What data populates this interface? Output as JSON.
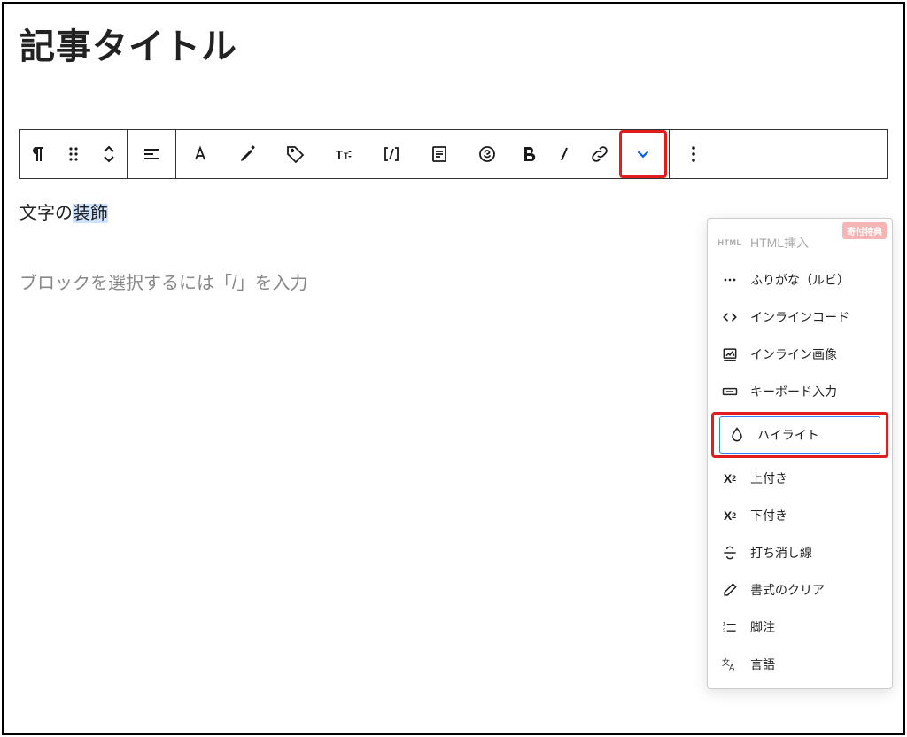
{
  "page_title": "記事タイトル",
  "content": {
    "prefix": "文字の",
    "highlighted": "装飾"
  },
  "placeholder": "ブロックを選択するには「/」を入力",
  "toolbar": {
    "paragraph": "段落",
    "drag": "ドラッグ",
    "move": "移動",
    "align": "配置",
    "text_color": "テキスト色",
    "highlight": "マーカー",
    "tag": "タグ",
    "font_size": "フォントサイズ",
    "shortcode": "ショートコード",
    "note": "注釈",
    "badge": "バッジ",
    "bold": "太字",
    "italic": "イタリック",
    "link": "リンク",
    "more": "さらに表示",
    "options": "オプション"
  },
  "dropdown": {
    "badge_label": "寄付特典",
    "items": [
      {
        "id": "html",
        "label": "HTML挿入",
        "icon_text": "HTML",
        "disabled": true
      },
      {
        "id": "ruby",
        "label": "ふりがな（ルビ）"
      },
      {
        "id": "code",
        "label": "インラインコード"
      },
      {
        "id": "image",
        "label": "インライン画像"
      },
      {
        "id": "kbd",
        "label": "キーボード入力"
      },
      {
        "id": "highlight",
        "label": "ハイライト",
        "selected": true
      },
      {
        "id": "sup",
        "label": "上付き"
      },
      {
        "id": "sub",
        "label": "下付き"
      },
      {
        "id": "strike",
        "label": "打ち消し線"
      },
      {
        "id": "clear",
        "label": "書式のクリア"
      },
      {
        "id": "footnote",
        "label": "脚注"
      },
      {
        "id": "lang",
        "label": "言語"
      }
    ]
  }
}
